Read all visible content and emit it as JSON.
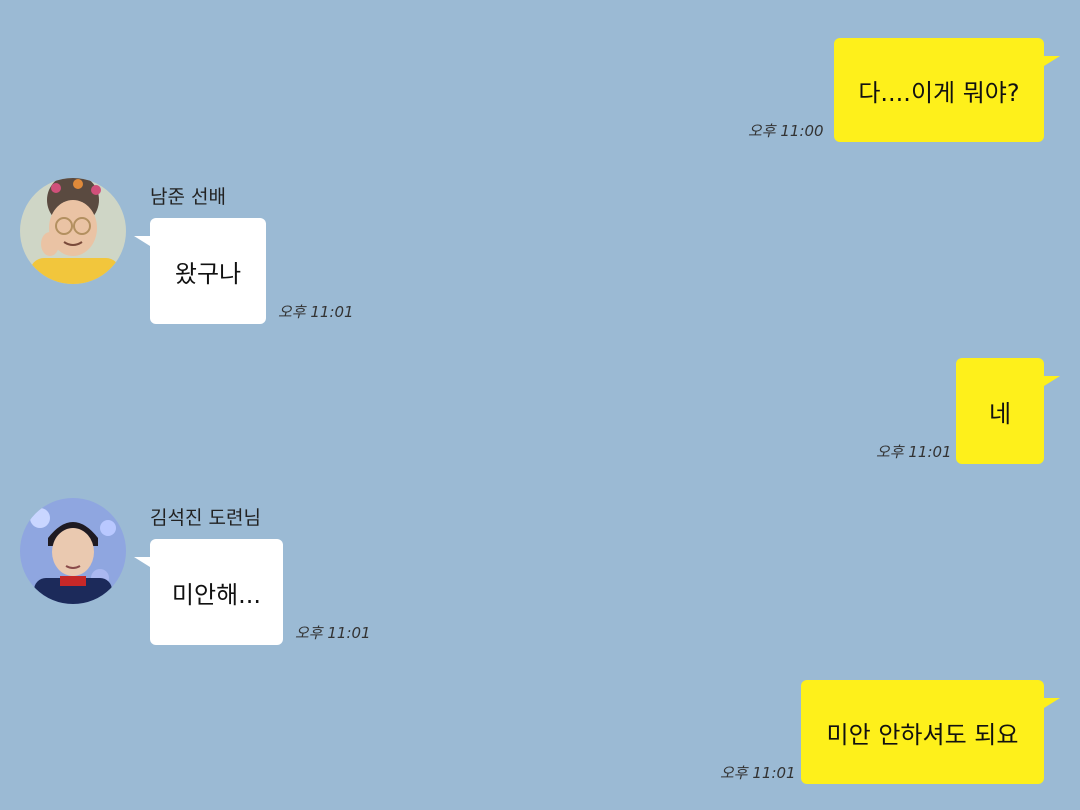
{
  "colors": {
    "background": "#9bbad4",
    "my_bubble": "#fef01b",
    "their_bubble": "#ffffff"
  },
  "messages": [
    {
      "from": "me",
      "text": "다....이게 뭐야?",
      "time": "오후 11:00"
    },
    {
      "from": "them",
      "sender": "남준 선배",
      "avatar": "person-avatar-icon",
      "text": "왔구나",
      "time": "오후 11:01"
    },
    {
      "from": "me",
      "text": "네",
      "time": "오후 11:01"
    },
    {
      "from": "them",
      "sender": "김석진 도련님",
      "avatar": "person-avatar-icon",
      "text": "미안해...",
      "time": "오후 11:01"
    },
    {
      "from": "me",
      "text": "미안 안하셔도 되요",
      "time": "오후 11:01"
    }
  ]
}
